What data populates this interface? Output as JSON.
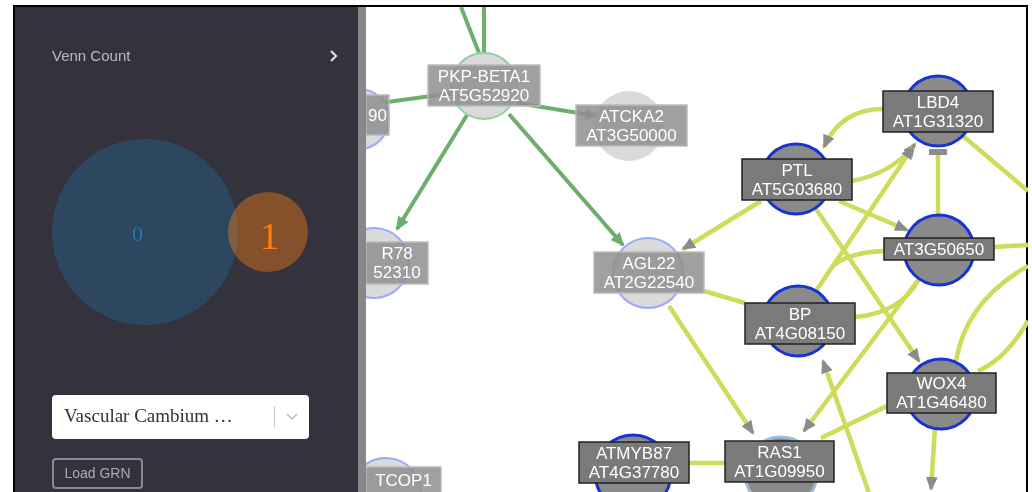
{
  "sidebar": {
    "title": "Venn Count",
    "venn": [
      {
        "label": "0",
        "color": "#1f77b4"
      },
      {
        "label": "1",
        "color": "#ff7f0e"
      }
    ],
    "network_select": {
      "value": "Vascular Cambium …"
    },
    "load_button": "Load GRN"
  },
  "network": {
    "nodes": [
      {
        "lines": [
          "PKP-BETA1",
          "AT5G52920"
        ],
        "highlighted": false
      },
      {
        "lines": [
          "90"
        ],
        "highlighted": false
      },
      {
        "lines": [
          "ATCKA2",
          "AT3G50000"
        ],
        "highlighted": false
      },
      {
        "lines": [
          "R78",
          "52310"
        ],
        "highlighted": false
      },
      {
        "lines": [
          "AGL22",
          "AT2G22540"
        ],
        "highlighted": false
      },
      {
        "lines": [
          "TCOP1"
        ],
        "highlighted": false
      },
      {
        "lines": [
          "LBD4",
          "AT1G31320"
        ],
        "highlighted": true
      },
      {
        "lines": [
          "PTL",
          "AT5G03680"
        ],
        "highlighted": true
      },
      {
        "lines": [
          "AT3G50650"
        ],
        "highlighted": true
      },
      {
        "lines": [
          "BP",
          "AT4G08150"
        ],
        "highlighted": true
      },
      {
        "lines": [
          "WOX4",
          "AT1G46480"
        ],
        "highlighted": true
      },
      {
        "lines": [
          "ATMYB87",
          "AT4G37780"
        ],
        "highlighted": true
      },
      {
        "lines": [
          "RAS1",
          "AT1G09950"
        ],
        "highlighted": true
      }
    ]
  }
}
